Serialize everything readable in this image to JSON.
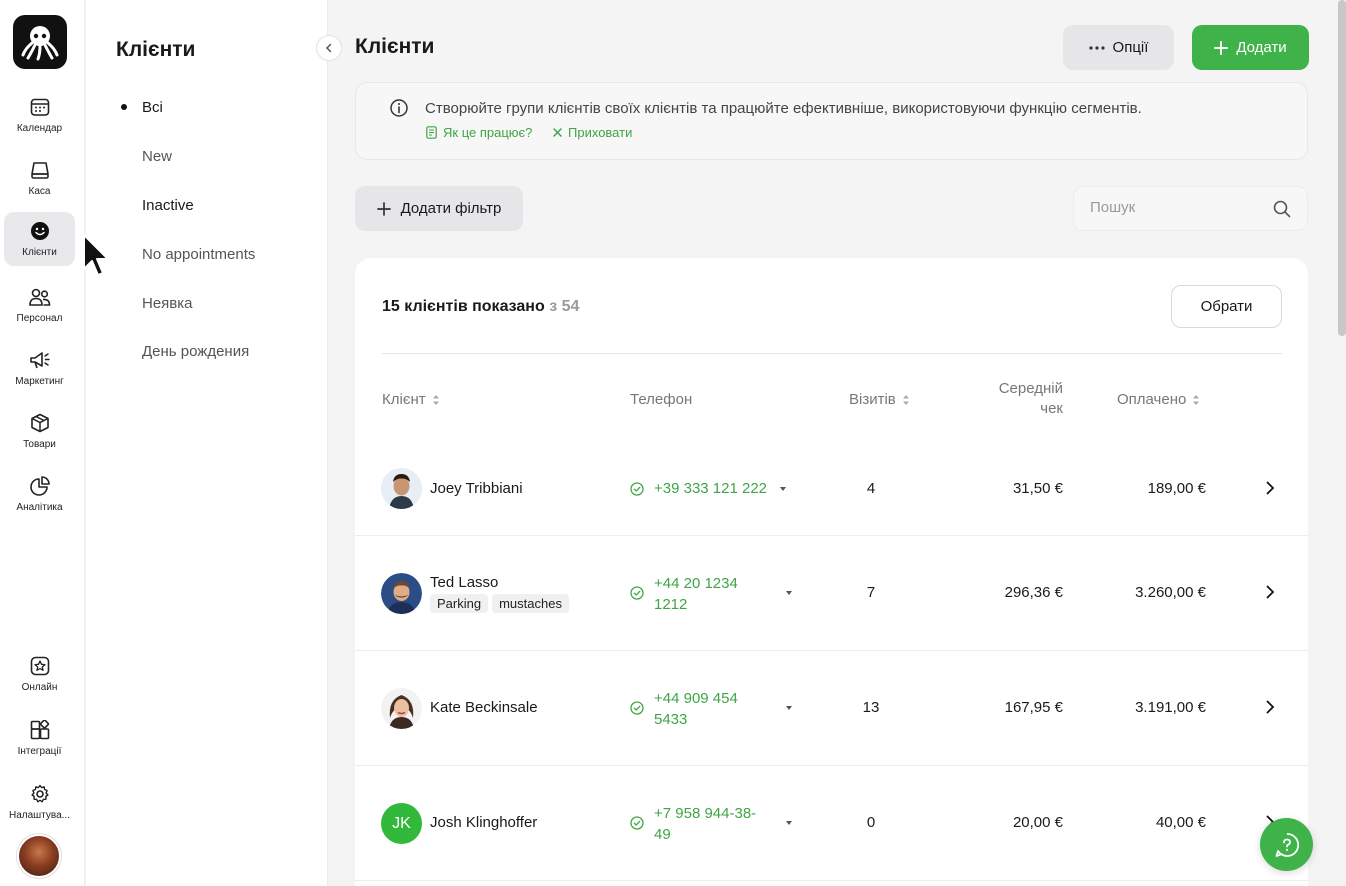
{
  "rail": {
    "items": [
      {
        "label": "Календар",
        "icon": "calendar-icon"
      },
      {
        "label": "Каса",
        "icon": "cash-register-icon"
      },
      {
        "label": "Клієнти",
        "icon": "smiley-icon",
        "active": true
      },
      {
        "label": "Персонал",
        "icon": "staff-icon"
      },
      {
        "label": "Маркетинг",
        "icon": "megaphone-icon"
      },
      {
        "label": "Товари",
        "icon": "box-icon"
      },
      {
        "label": "Аналітика",
        "icon": "pie-chart-icon"
      }
    ],
    "bottom_items": [
      {
        "label": "Онлайн",
        "icon": "star-card-icon"
      },
      {
        "label": "Інтеграції",
        "icon": "integrations-icon"
      },
      {
        "label": "Налаштува...",
        "icon": "gear-icon"
      }
    ]
  },
  "segments": {
    "title": "Клієнти",
    "items": [
      "Всі",
      "New",
      "Inactive",
      "No appointments",
      "Неявка",
      "День рождения"
    ]
  },
  "header": {
    "title": "Клієнти",
    "options_label": "Опції",
    "add_label": "Додати"
  },
  "info": {
    "text": "Створюйте групи клієнтів своїх клієнтів та працюйте ефективніше, використовуючи функцію сегментів.",
    "how_label": "Як це працює?",
    "hide_label": "Приховати"
  },
  "toolbar": {
    "filter_label": "Додати фільтр",
    "search_placeholder": "Пошук"
  },
  "table": {
    "shown": "15 клієнтів показано",
    "of": "з 54",
    "select_label": "Обрати",
    "columns": {
      "client": "Клієнт",
      "phone": "Телефон",
      "visits": "Візитів",
      "avg_check_1": "Середній",
      "avg_check_2": "чек",
      "paid": "Оплачено"
    },
    "rows": [
      {
        "name": "Joey Tribbiani",
        "tags": [],
        "phone_1": "+39 333 121 222",
        "phone_2": "",
        "visits": "4",
        "avg": "31,50 €",
        "paid": "189,00 €"
      },
      {
        "name": "Ted Lasso",
        "tags": [
          "Parking",
          "mustaches"
        ],
        "phone_1": "+44 20 1234",
        "phone_2": "1212",
        "visits": "7",
        "avg": "296,36 €",
        "paid": "3.260,00 €"
      },
      {
        "name": "Kate Beckinsale",
        "tags": [],
        "phone_1": "+44 909 454",
        "phone_2": "5433",
        "visits": "13",
        "avg": "167,95 €",
        "paid": "3.191,00 €"
      },
      {
        "name": "Josh Klinghoffer",
        "initials": "JK",
        "tags": [],
        "phone_1": "+7 958 944-38-",
        "phone_2": "49",
        "visits": "0",
        "avg": "20,00 €",
        "paid": "40,00 €"
      }
    ]
  },
  "colors": {
    "accent": "#3fb34a",
    "link": "#3fa545"
  }
}
